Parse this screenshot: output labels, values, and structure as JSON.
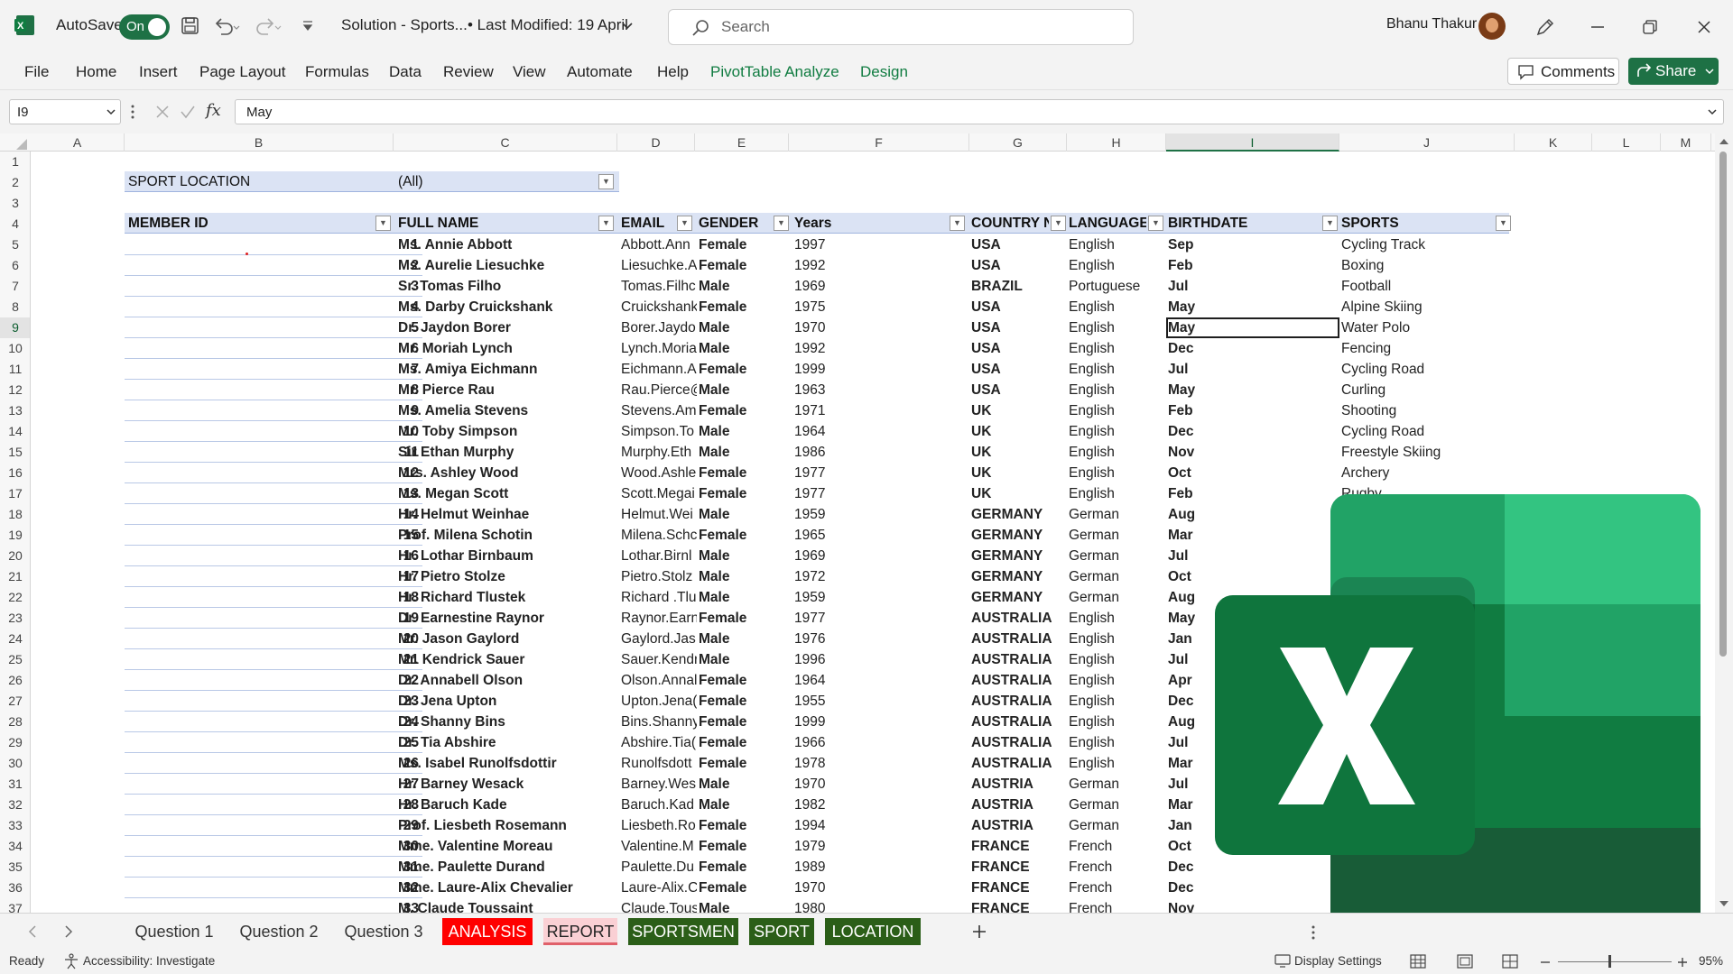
{
  "titlebar": {
    "autosave_label": "AutoSave",
    "autosave_state": "On",
    "file_name": "Solution - Sports...",
    "last_modified": "• Last Modified: 19 April",
    "search_placeholder": "Search",
    "user_name": "Bhanu Thakur"
  },
  "menu": {
    "items": [
      "File",
      "Home",
      "Insert",
      "Page Layout",
      "Formulas",
      "Data",
      "Review",
      "View",
      "Automate",
      "Help",
      "PivotTable Analyze",
      "Design"
    ],
    "comments_label": "Comments",
    "share_label": "Share"
  },
  "formula_bar": {
    "name_box": "I9",
    "fx": "fx",
    "value": "May"
  },
  "columns": [
    "A",
    "B",
    "C",
    "D",
    "E",
    "F",
    "G",
    "H",
    "I",
    "J",
    "K",
    "L",
    "M"
  ],
  "selected_column": "I",
  "selected_row": 9,
  "pivot": {
    "filter_label": "SPORT LOCATION",
    "filter_value": "(All)",
    "headers": [
      "MEMBER ID",
      "FULL NAME",
      "EMAIL",
      "GENDER",
      "Years",
      "COUNTRY N",
      "LANGUAGE",
      "BIRTHDATE",
      "SPORTS"
    ],
    "rows": [
      [
        "1",
        "Ms. Annie Abbott",
        "Abbott.Ann",
        "Female",
        "1997",
        "USA",
        "English",
        "Sep",
        "Cycling Track"
      ],
      [
        "2",
        "Ms. Aurelie Liesuchke",
        "Liesuchke.A",
        "Female",
        "1992",
        "USA",
        "English",
        "Feb",
        "Boxing"
      ],
      [
        "3",
        "Sr. Tomas Filho",
        "Tomas.Filhc",
        "Male",
        "1969",
        "BRAZIL",
        "Portuguese",
        "Jul",
        "Football"
      ],
      [
        "4",
        "Ms. Darby Cruickshank",
        "Cruickshank",
        "Female",
        "1975",
        "USA",
        "English",
        "May",
        "Alpine Skiing"
      ],
      [
        "5",
        "Dr. Jaydon Borer",
        "Borer.Jaydo",
        "Male",
        "1970",
        "USA",
        "English",
        "May",
        "Water Polo"
      ],
      [
        "6",
        "Mr. Moriah  Lynch",
        "Lynch.Moria",
        "Male",
        "1992",
        "USA",
        "English",
        "Dec",
        "Fencing"
      ],
      [
        "7",
        "Ms. Amiya Eichmann",
        "Eichmann.A",
        "Female",
        "1999",
        "USA",
        "English",
        "Jul",
        "Cycling Road"
      ],
      [
        "8",
        "Mr. Pierce Rau",
        "Rau.Pierce@",
        "Male",
        "1963",
        "USA",
        "English",
        "May",
        "Curling"
      ],
      [
        "9",
        "Ms. Amelia Stevens",
        "Stevens.Am",
        "Female",
        "1971",
        "UK",
        "English",
        "Feb",
        "Shooting"
      ],
      [
        "10",
        "Mr. Toby Simpson",
        "Simpson.To",
        "Male",
        "1964",
        "UK",
        "English",
        "Dec",
        "Cycling Road"
      ],
      [
        "11",
        "Sir Ethan Murphy",
        "Murphy.Eth",
        "Male",
        "1986",
        "UK",
        "English",
        "Nov",
        "Freestyle Skiing"
      ],
      [
        "12",
        "Mrs. Ashley Wood",
        "Wood.Ashle",
        "Female",
        "1977",
        "UK",
        "English",
        "Oct",
        "Archery"
      ],
      [
        "13",
        "Ms. Megan Scott",
        "Scott.Megai",
        "Female",
        "1977",
        "UK",
        "English",
        "Feb",
        "Rugby"
      ],
      [
        "14",
        "Hr. Helmut Weinhae",
        "Helmut.Wei",
        "Male",
        "1959",
        "GERMANY",
        "German",
        "Aug",
        ""
      ],
      [
        "15",
        "Prof. Milena Schotin",
        "Milena.Schc",
        "Female",
        "1965",
        "GERMANY",
        "German",
        "Mar",
        ""
      ],
      [
        "16",
        "Hr. Lothar Birnbaum",
        "Lothar.Birnl",
        "Male",
        "1969",
        "GERMANY",
        "German",
        "Jul",
        ""
      ],
      [
        "17",
        "Hr. Pietro Stolze",
        "Pietro.Stolz",
        "Male",
        "1972",
        "GERMANY",
        "German",
        "Oct",
        ""
      ],
      [
        "18",
        "Hr. Richard  Tlustek",
        "Richard .Tlu",
        "Male",
        "1959",
        "GERMANY",
        "German",
        "Aug",
        ""
      ],
      [
        "19",
        "Dr. Earnestine Raynor",
        "Raynor.Earn",
        "Female",
        "1977",
        "AUSTRALIA",
        "English",
        "May",
        ""
      ],
      [
        "20",
        "Mr. Jason Gaylord",
        "Gaylord.Jas",
        "Male",
        "1976",
        "AUSTRALIA",
        "English",
        "Jan",
        ""
      ],
      [
        "21",
        "Mr. Kendrick Sauer",
        "Sauer.Kendr",
        "Male",
        "1996",
        "AUSTRALIA",
        "English",
        "Jul",
        ""
      ],
      [
        "22",
        "Dr. Annabell Olson",
        "Olson.Annal",
        "Female",
        "1964",
        "AUSTRALIA",
        "English",
        "Apr",
        ""
      ],
      [
        "23",
        "Dr. Jena Upton",
        "Upton.Jena(",
        "Female",
        "1955",
        "AUSTRALIA",
        "English",
        "Dec",
        ""
      ],
      [
        "24",
        "Dr. Shanny Bins",
        "Bins.Shanny",
        "Female",
        "1999",
        "AUSTRALIA",
        "English",
        "Aug",
        ""
      ],
      [
        "25",
        "Dr. Tia Abshire",
        "Abshire.Tia(",
        "Female",
        "1966",
        "AUSTRALIA",
        "English",
        "Jul",
        ""
      ],
      [
        "26",
        "Ms. Isabel Runolfsdottir",
        "Runolfsdott",
        "Female",
        "1978",
        "AUSTRALIA",
        "English",
        "Mar",
        ""
      ],
      [
        "27",
        "Hr. Barney Wesack",
        "Barney.Wes",
        "Male",
        "1970",
        "AUSTRIA",
        "German",
        "Jul",
        ""
      ],
      [
        "28",
        "Hr. Baruch Kade",
        "Baruch.Kad",
        "Male",
        "1982",
        "AUSTRIA",
        "German",
        "Mar",
        ""
      ],
      [
        "29",
        "Prof. Liesbeth Rosemann",
        "Liesbeth.Ro",
        "Female",
        "1994",
        "AUSTRIA",
        "German",
        "Jan",
        ""
      ],
      [
        "30",
        "Mme. Valentine Moreau",
        "Valentine.M",
        "Female",
        "1979",
        "FRANCE",
        "French",
        "Oct",
        ""
      ],
      [
        "31",
        "Mme. Paulette Durand",
        "Paulette.Du",
        "Female",
        "1989",
        "FRANCE",
        "French",
        "Dec",
        ""
      ],
      [
        "32",
        "Mme. Laure-Alix Chevalier",
        "Laure-Alix.C",
        "Female",
        "1970",
        "FRANCE",
        "French",
        "Dec",
        ""
      ],
      [
        "33",
        "M. Claude Toussaint",
        "Claude.Tous",
        "Male",
        "1980",
        "FRANCE",
        "French",
        "Nov",
        ""
      ]
    ]
  },
  "sheet_tabs": [
    {
      "label": "Question 1",
      "style": "plain"
    },
    {
      "label": "Question 2",
      "style": "plain"
    },
    {
      "label": "Question 3",
      "style": "plain"
    },
    {
      "label": "ANALYSIS",
      "style": "red"
    },
    {
      "label": "REPORT",
      "style": "pink"
    },
    {
      "label": "SPORTSMEN",
      "style": "dgreen"
    },
    {
      "label": "SPORT",
      "style": "dgreen"
    },
    {
      "label": "LOCATION",
      "style": "dgreen"
    }
  ],
  "status": {
    "ready": "Ready",
    "accessibility": "Accessibility: Investigate",
    "display_settings": "Display Settings",
    "zoom": "95%"
  },
  "colors": {
    "excel_green": "#1e7145",
    "header_fill": "#dbe3f4",
    "analysis_tab": "#ff0000",
    "data_tab": "#2b5e18"
  },
  "icons": [
    "excel-app-icon",
    "save-icon",
    "undo-icon",
    "redo-icon",
    "search-icon",
    "pen-icon",
    "minimize-icon",
    "restore-icon",
    "close-icon",
    "comment-icon",
    "share-icon",
    "fx-icon",
    "filter-dropdown-icon",
    "add-sheet-icon",
    "excel-logo"
  ]
}
